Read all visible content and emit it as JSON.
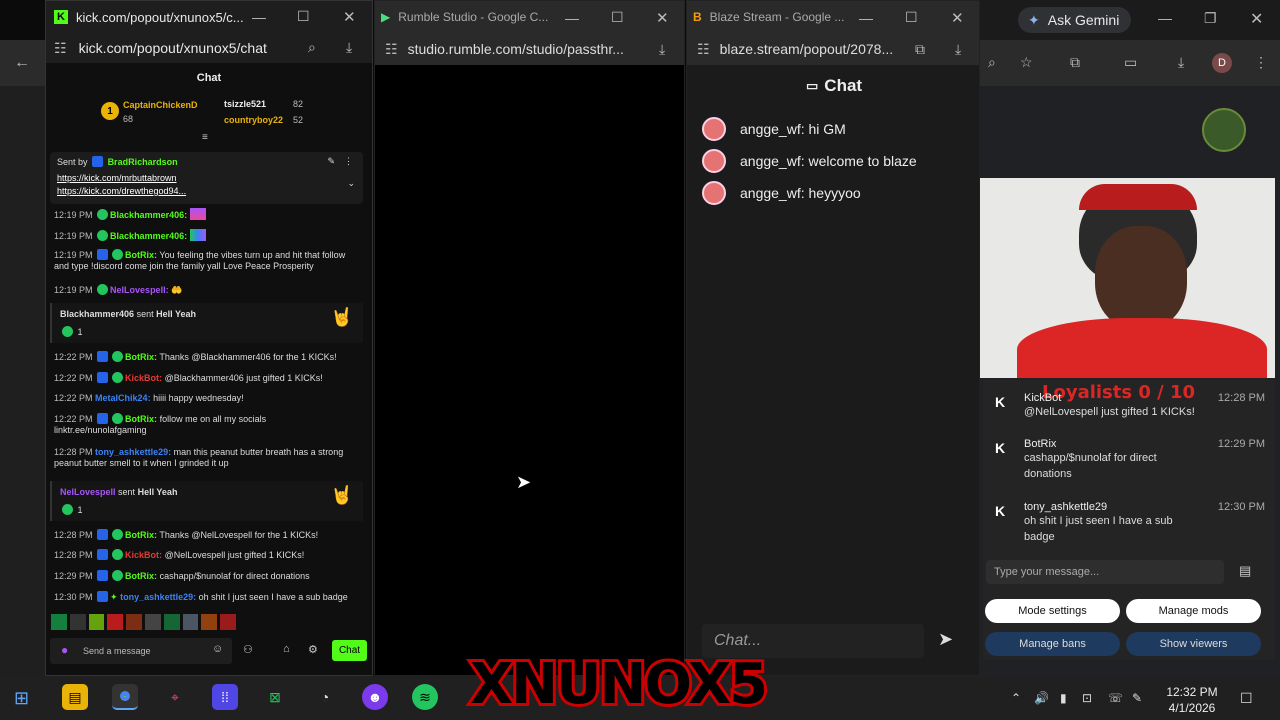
{
  "bg_browser": {
    "gemini_label": "Ask Gemini",
    "avatar_letter": "D"
  },
  "kick_window": {
    "title": "kick.com/popout/xnunox5/c...",
    "url": "kick.com/popout/xnunox5/chat",
    "chat_header": "Chat",
    "leaderboard": [
      {
        "rank": "1",
        "name": "CaptainChickenD",
        "score": "68"
      },
      {
        "rank": "",
        "name": "tsizzle521",
        "score": "82"
      },
      {
        "rank": "",
        "name": "countryboy22",
        "score": "52"
      }
    ],
    "pin": {
      "sent_by": "Sent by",
      "sender": "BradRichardson",
      "link1": "https://kick.com/mrbuttabrown",
      "link2": "https://kick.com/drewthegod94..."
    },
    "messages": [
      {
        "time": "12:19 PM",
        "user": "Blackhammer406:",
        "text": ""
      },
      {
        "time": "12:19 PM",
        "user": "Blackhammer406:",
        "text": ""
      },
      {
        "time": "12:19 PM",
        "user": "BotRix:",
        "text": "You feeling the vibes turn up and hit that follow and type !discord come join the family yall Love Peace Prosperity"
      },
      {
        "time": "12:19 PM",
        "user": "NelLovespell:",
        "text": ""
      },
      {
        "time": "12:22 PM",
        "user": "BotRix:",
        "text": "Thanks @Blackhammer406 for the 1 KICKs!"
      },
      {
        "time": "12:22 PM",
        "user": "KickBot:",
        "text": "@Blackhammer406 just gifted 1 KICKs!"
      },
      {
        "time": "12:22 PM",
        "user": "MetalChik24:",
        "text": "hiiii happy wednesday!"
      },
      {
        "time": "12:22 PM",
        "user": "BotRix:",
        "text": "follow me on all my socials linktr.ee/nunolafgaming"
      },
      {
        "time": "12:28 PM",
        "user": "tony_ashkettle29:",
        "text": "man this peanut butter breath has a strong peanut butter smell to it when I grinded it up"
      },
      {
        "time": "12:28 PM",
        "user": "BotRix:",
        "text": "Thanks @NelLovespell for the 1 KICKs!"
      },
      {
        "time": "12:28 PM",
        "user": "KickBot:",
        "text": "@NelLovespell just gifted 1 KICKs!"
      },
      {
        "time": "12:29 PM",
        "user": "BotRix:",
        "text": "cashapp/$nunolaf for direct donations"
      },
      {
        "time": "12:30 PM",
        "user": "tony_ashkettle29:",
        "text": "oh shit I just seen I have a sub badge"
      }
    ],
    "gifts": [
      {
        "user": "Blackhammer406",
        "sent": "sent",
        "item": "Hell Yeah",
        "count": "1"
      },
      {
        "user": "NelLovespell",
        "sent": "sent",
        "item": "Hell Yeah",
        "count": "1"
      }
    ],
    "input_placeholder": "Send a message",
    "chat_button": "Chat"
  },
  "rumble_window": {
    "title": "Rumble Studio - Google C...",
    "url": "studio.rumble.com/studio/passthr..."
  },
  "blaze_window": {
    "title": "Blaze Stream - Google ...",
    "url": "blaze.stream/popout/2078...",
    "chat_header": "Chat",
    "messages": [
      {
        "user": "angge_wf:",
        "text": "hi GM"
      },
      {
        "user": "angge_wf:",
        "text": "welcome to blaze"
      },
      {
        "user": "angge_wf:",
        "text": "heyyyoo"
      }
    ],
    "input_placeholder": "Chat..."
  },
  "overlay": {
    "loyalists": "Loyalists  0 / 10",
    "messages": [
      {
        "user": "KickBot",
        "text": "@NelLovespell just gifted 1 KICKs!",
        "time": "12:28 PM"
      },
      {
        "user": "BotRix",
        "text": "cashapp/$nunolaf for direct donations",
        "time": "12:29 PM"
      },
      {
        "user": "tony_ashkettle29",
        "text": "oh shit I just seen I have a sub badge",
        "time": "12:30 PM"
      }
    ],
    "input_placeholder": "Type your message...",
    "buttons": {
      "mode": "Mode settings",
      "mods": "Manage mods",
      "bans": "Manage bans",
      "viewers": "Show viewers"
    }
  },
  "stream_logo": "XNUNOX5",
  "taskbar": {
    "time": "12:32 PM",
    "date": "4/1/2026"
  }
}
